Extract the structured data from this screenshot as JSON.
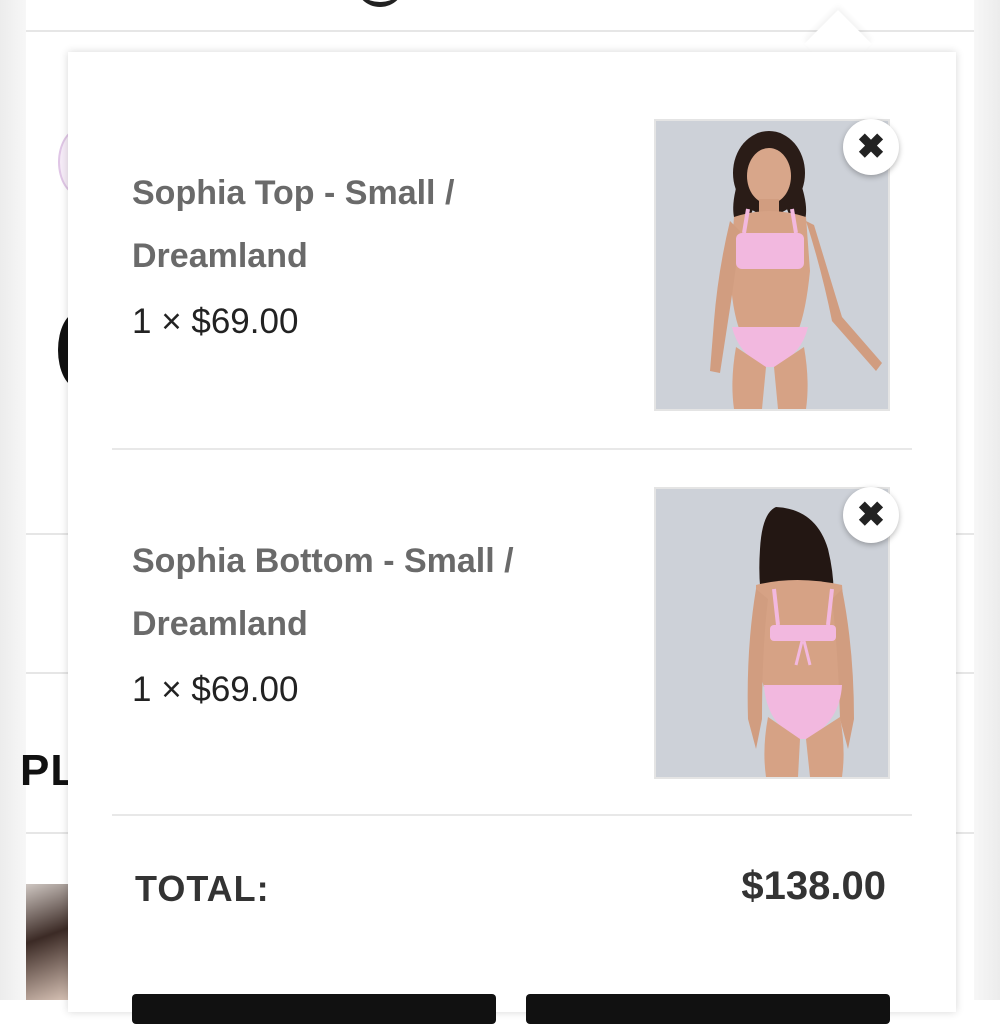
{
  "cart": {
    "items": [
      {
        "name": "Sophia Top - Small / Dreamland",
        "name_line1": "Sophia Top - Small /",
        "name_line2": "Dreamland",
        "quantity_price": "1 × $69.00",
        "image_icon": "product-photo-front"
      },
      {
        "name": "Sophia Bottom - Small / Dreamland",
        "name_line1": "Sophia Bottom - Small /",
        "name_line2": "Dreamland",
        "quantity_price": "1 × $69.00",
        "image_icon": "product-photo-back"
      }
    ],
    "remove_icon": "close-icon",
    "remove_glyph": "✖",
    "total_label": "TOTAL:",
    "total_value": "$138.00"
  },
  "background": {
    "partial_heading": "PL"
  },
  "colors": {
    "product_pink": "#f2b8df",
    "item_name_text": "#6a6a6a",
    "price_text": "#222222",
    "button_dark": "#111111"
  }
}
